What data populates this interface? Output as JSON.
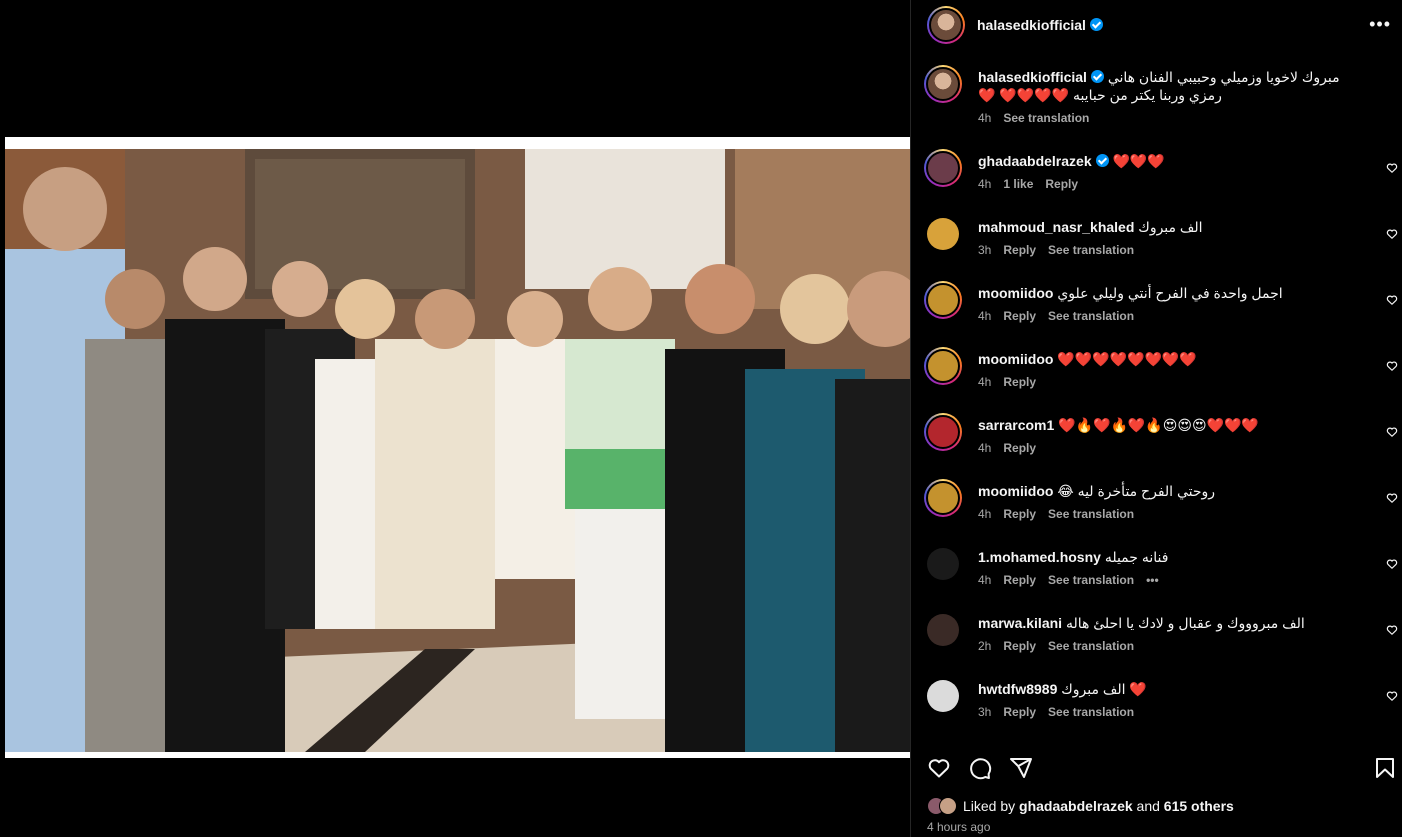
{
  "post": {
    "author": "halasedkiofficial",
    "more_label": "•••",
    "photo_alt": "Group photo at an evening event"
  },
  "caption": {
    "user": "halasedkiofficial",
    "text": "مبروك لاخويا وزميلي وحبيبي الفنان هاني رمزي وربنا يكتر من حبايبه ❤️❤️❤️❤️ ❤️",
    "time": "4h",
    "see_translation": "See translation"
  },
  "comments": [
    {
      "user": "ghadaabdelrazek",
      "verified": true,
      "text": "❤️❤️❤️",
      "time": "4h",
      "likes": "1 like",
      "reply": "Reply",
      "translate": "",
      "avatar": "#6b3c4a"
    },
    {
      "user": "mahmoud_nasr_khaled",
      "verified": false,
      "text": "الف مبروك",
      "time": "3h",
      "likes": "",
      "reply": "Reply",
      "translate": "See translation",
      "avatar": "#d8a23a"
    },
    {
      "user": "moomiidoo",
      "verified": false,
      "text": "اجمل واحدة في الفرح أنتي وليلي علوي",
      "time": "4h",
      "likes": "",
      "reply": "Reply",
      "translate": "See translation",
      "avatar": "#c4922e"
    },
    {
      "user": "moomiidoo",
      "verified": false,
      "text": "❤️❤️❤️❤️❤️❤️❤️❤️",
      "time": "4h",
      "likes": "",
      "reply": "Reply",
      "translate": "",
      "avatar": "#c4922e"
    },
    {
      "user": "sarrarcom1",
      "verified": false,
      "text": "❤️🔥❤️🔥❤️🔥😍😍😍❤️❤️❤️",
      "time": "4h",
      "likes": "",
      "reply": "Reply",
      "translate": "",
      "avatar": "#b3262d"
    },
    {
      "user": "moomiidoo",
      "verified": false,
      "text": "روحتي الفرح متأخرة ليه 😂",
      "time": "4h",
      "likes": "",
      "reply": "Reply",
      "translate": "See translation",
      "avatar": "#c4922e"
    },
    {
      "user": "1.mohamed.hosny",
      "verified": false,
      "text": "فنانه جميله",
      "time": "4h",
      "likes": "",
      "reply": "Reply",
      "translate": "See translation",
      "extra": "•••",
      "avatar": "#1a1a1a"
    },
    {
      "user": "marwa.kilani",
      "verified": false,
      "text": "الف مبروووك و عقبال و لادك يا احلئ هاله",
      "time": "2h",
      "likes": "",
      "reply": "Reply",
      "translate": "See translation",
      "avatar": "#3a2a26"
    },
    {
      "user": "hwtdfw8989",
      "verified": false,
      "text": "❤️ الف مبروك",
      "time": "3h",
      "likes": "",
      "reply": "Reply",
      "translate": "See translation",
      "avatar": "#dbdbdb"
    }
  ],
  "likes": {
    "prefix": "Liked by",
    "user": "ghadaabdelrazek",
    "and": "and",
    "others": "615 others"
  },
  "timestamp": "4 hours ago",
  "icons": {
    "like": "heart-icon",
    "comment": "comment-icon",
    "share": "share-icon",
    "save": "bookmark-icon"
  },
  "colors": {
    "verified": "#0095f6",
    "secondary_text": "#a8a8a8",
    "background": "#000000"
  }
}
